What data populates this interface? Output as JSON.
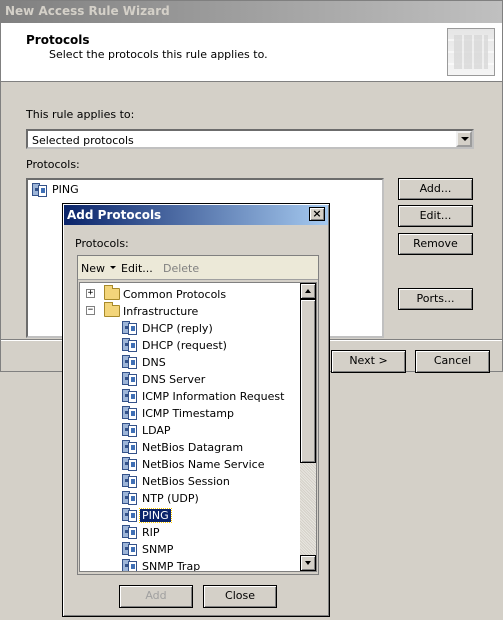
{
  "wizard": {
    "title": "New Access Rule Wizard",
    "header_title": "Protocols",
    "header_subtitle": "Select the protocols this rule applies to.",
    "applies_label": "This rule applies to:",
    "applies_value": "Selected protocols",
    "protocols_label": "Protocols:",
    "protocols_list": [
      "PING"
    ],
    "buttons": {
      "add": "Add...",
      "edit": "Edit...",
      "remove": "Remove",
      "ports": "Ports...",
      "next": "Next >",
      "cancel": "Cancel"
    }
  },
  "dialog": {
    "title": "Add Protocols",
    "close_glyph": "×",
    "protocols_label": "Protocols:",
    "toolbar": {
      "new": "New",
      "edit": "Edit...",
      "delete": "Delete"
    },
    "tree": {
      "folders": [
        {
          "label": "Common Protocols",
          "expander": "+"
        },
        {
          "label": "Infrastructure",
          "expander": "−"
        }
      ],
      "items": [
        "DHCP (reply)",
        "DHCP (request)",
        "DNS",
        "DNS Server",
        "ICMP Information Request",
        "ICMP Timestamp",
        "LDAP",
        "NetBios Datagram",
        "NetBios Name Service",
        "NetBios Session",
        "NTP (UDP)",
        "PING",
        "RIP",
        "SNMP",
        "SNMP Trap"
      ],
      "selected": "PING"
    },
    "buttons": {
      "add": "Add",
      "close": "Close"
    }
  }
}
